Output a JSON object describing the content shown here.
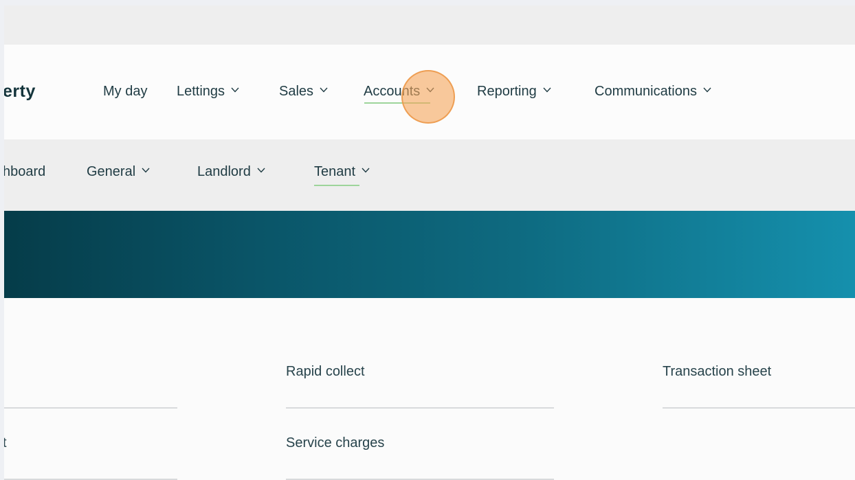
{
  "brand": {
    "text": "erty"
  },
  "main_nav": {
    "items": [
      {
        "label": "My day",
        "has_dropdown": false
      },
      {
        "label": "Lettings",
        "has_dropdown": true
      },
      {
        "label": "Sales",
        "has_dropdown": true
      },
      {
        "label": "Accounts",
        "has_dropdown": true,
        "active": true
      },
      {
        "label": "Reporting",
        "has_dropdown": true
      },
      {
        "label": "Communications",
        "has_dropdown": true
      }
    ]
  },
  "sub_nav": {
    "items": [
      {
        "label": "hboard",
        "has_dropdown": false
      },
      {
        "label": "General",
        "has_dropdown": true
      },
      {
        "label": "Landlord",
        "has_dropdown": true
      },
      {
        "label": "Tenant",
        "has_dropdown": true,
        "active": true
      }
    ]
  },
  "content": {
    "links": [
      {
        "label": "Rapid collect"
      },
      {
        "label": "Transaction sheet"
      },
      {
        "label": "t"
      },
      {
        "label": "Service charges"
      }
    ]
  },
  "colors": {
    "active_underline": "#9dd49a",
    "banner_start": "#053c49",
    "banner_end": "#1590ad",
    "click_indicator": "#f5a55a"
  },
  "icons": {
    "dropdown": "chevron-down-icon"
  }
}
